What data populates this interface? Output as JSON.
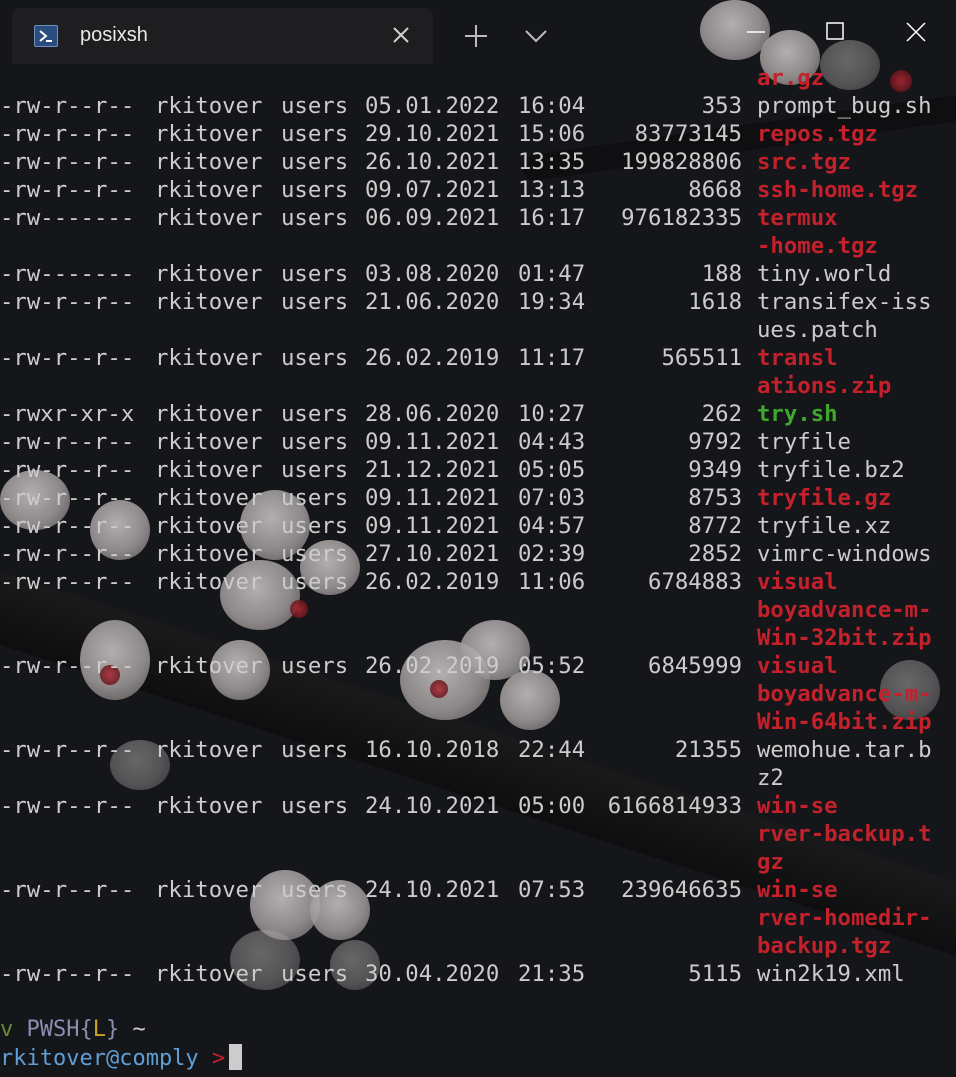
{
  "window": {
    "tab_title": "posixsh",
    "tab_icon": "powershell-icon",
    "new_tab_icon": "plus-icon",
    "dropdown_icon": "chevron-down-icon",
    "controls": [
      "minimize-icon",
      "maximize-icon",
      "close-icon"
    ]
  },
  "colors": {
    "archive": "#c3212b",
    "executable": "#3da82b",
    "text": "#cccccc",
    "background": "#141619"
  },
  "listing": {
    "top_partial": "ar.gz",
    "rows": [
      {
        "perm": "-rw-r--r--",
        "owner": "rkitover",
        "group": "users",
        "date": "05.01.2022",
        "time": "16:04",
        "size": "353",
        "name": [
          "prompt_bug.sh"
        ],
        "kind": "plain"
      },
      {
        "perm": "-rw-r--r--",
        "owner": "rkitover",
        "group": "users",
        "date": "29.10.2021",
        "time": "15:06",
        "size": "83773145",
        "name": [
          "repos.tgz"
        ],
        "kind": "red"
      },
      {
        "perm": "-rw-r--r--",
        "owner": "rkitover",
        "group": "users",
        "date": "26.10.2021",
        "time": "13:35",
        "size": "199828806",
        "name": [
          "src.tgz"
        ],
        "kind": "red"
      },
      {
        "perm": "-rw-r--r--",
        "owner": "rkitover",
        "group": "users",
        "date": "09.07.2021",
        "time": "13:13",
        "size": "8668",
        "name": [
          "ssh-home.tgz"
        ],
        "kind": "red"
      },
      {
        "perm": "-rw-------",
        "owner": "rkitover",
        "group": "users",
        "date": "06.09.2021",
        "time": "16:17",
        "size": "976182335",
        "name": [
          "termux",
          "-home.tgz"
        ],
        "kind": "red"
      },
      {
        "perm": "-rw-------",
        "owner": "rkitover",
        "group": "users",
        "date": "03.08.2020",
        "time": "01:47",
        "size": "188",
        "name": [
          "tiny.world"
        ],
        "kind": "plain"
      },
      {
        "perm": "-rw-r--r--",
        "owner": "rkitover",
        "group": "users",
        "date": "21.06.2020",
        "time": "19:34",
        "size": "1618",
        "name": [
          "transifex-iss",
          "ues.patch"
        ],
        "kind": "plain"
      },
      {
        "perm": "-rw-r--r--",
        "owner": "rkitover",
        "group": "users",
        "date": "26.02.2019",
        "time": "11:17",
        "size": "565511",
        "name": [
          "transl",
          "ations.zip"
        ],
        "kind": "red"
      },
      {
        "perm": "-rwxr-xr-x",
        "owner": "rkitover",
        "group": "users",
        "date": "28.06.2020",
        "time": "10:27",
        "size": "262",
        "name": [
          "try.sh"
        ],
        "kind": "green"
      },
      {
        "perm": "-rw-r--r--",
        "owner": "rkitover",
        "group": "users",
        "date": "09.11.2021",
        "time": "04:43",
        "size": "9792",
        "name": [
          "tryfile"
        ],
        "kind": "plain"
      },
      {
        "perm": "-rw-r--r--",
        "owner": "rkitover",
        "group": "users",
        "date": "21.12.2021",
        "time": "05:05",
        "size": "9349",
        "name": [
          "tryfile.bz2"
        ],
        "kind": "plain"
      },
      {
        "perm": "-rw-r--r--",
        "owner": "rkitover",
        "group": "users",
        "date": "09.11.2021",
        "time": "07:03",
        "size": "8753",
        "name": [
          "tryfile.gz"
        ],
        "kind": "red"
      },
      {
        "perm": "-rw-r--r--",
        "owner": "rkitover",
        "group": "users",
        "date": "09.11.2021",
        "time": "04:57",
        "size": "8772",
        "name": [
          "tryfile.xz"
        ],
        "kind": "plain"
      },
      {
        "perm": "-rw-r--r--",
        "owner": "rkitover",
        "group": "users",
        "date": "27.10.2021",
        "time": "02:39",
        "size": "2852",
        "name": [
          "vimrc-windows"
        ],
        "kind": "plain"
      },
      {
        "perm": "-rw-r--r--",
        "owner": "rkitover",
        "group": "users",
        "date": "26.02.2019",
        "time": "11:06",
        "size": "6784883",
        "name": [
          "visual",
          "boyadvance-m-",
          "Win-32bit.zip"
        ],
        "kind": "red"
      },
      {
        "perm": "-rw-r--r--",
        "owner": "rkitover",
        "group": "users",
        "date": "26.02.2019",
        "time": "05:52",
        "size": "6845999",
        "name": [
          "visual",
          "boyadvance-m-",
          "Win-64bit.zip"
        ],
        "kind": "red"
      },
      {
        "perm": "-rw-r--r--",
        "owner": "rkitover",
        "group": "users",
        "date": "16.10.2018",
        "time": "22:44",
        "size": "21355",
        "name": [
          "wemohue.tar.b",
          "z2"
        ],
        "kind": "plain"
      },
      {
        "perm": "-rw-r--r--",
        "owner": "rkitover",
        "group": "users",
        "date": "24.10.2021",
        "time": "05:00",
        "size": "6166814933",
        "name": [
          "win-se",
          "rver-backup.t",
          "gz"
        ],
        "kind": "red"
      },
      {
        "perm": "-rw-r--r--",
        "owner": "rkitover",
        "group": "users",
        "date": "24.10.2021",
        "time": "07:53",
        "size": "239646635",
        "name": [
          "win-se",
          "rver-homedir-",
          "backup.tgz"
        ],
        "kind": "red"
      },
      {
        "perm": "-rw-r--r--",
        "owner": "rkitover",
        "group": "users",
        "date": "30.04.2020",
        "time": "21:35",
        "size": "5115",
        "name": [
          "win2k19.xml"
        ],
        "kind": "plain"
      }
    ]
  },
  "prompt": {
    "line1": {
      "v": "v",
      "shell": "PWSH",
      "brace_open": "{",
      "mode": "L",
      "brace_close": "}",
      "tilde": "~"
    },
    "line2": {
      "user_host": "rkitover@comply",
      "arrow": ">"
    },
    "prompt_colors": {
      "v": "#6a8a3a",
      "shell": "#8a8fb0",
      "mode": "#c9a227",
      "user": "#5f9fd6",
      "arrow": "#c3212b"
    }
  }
}
